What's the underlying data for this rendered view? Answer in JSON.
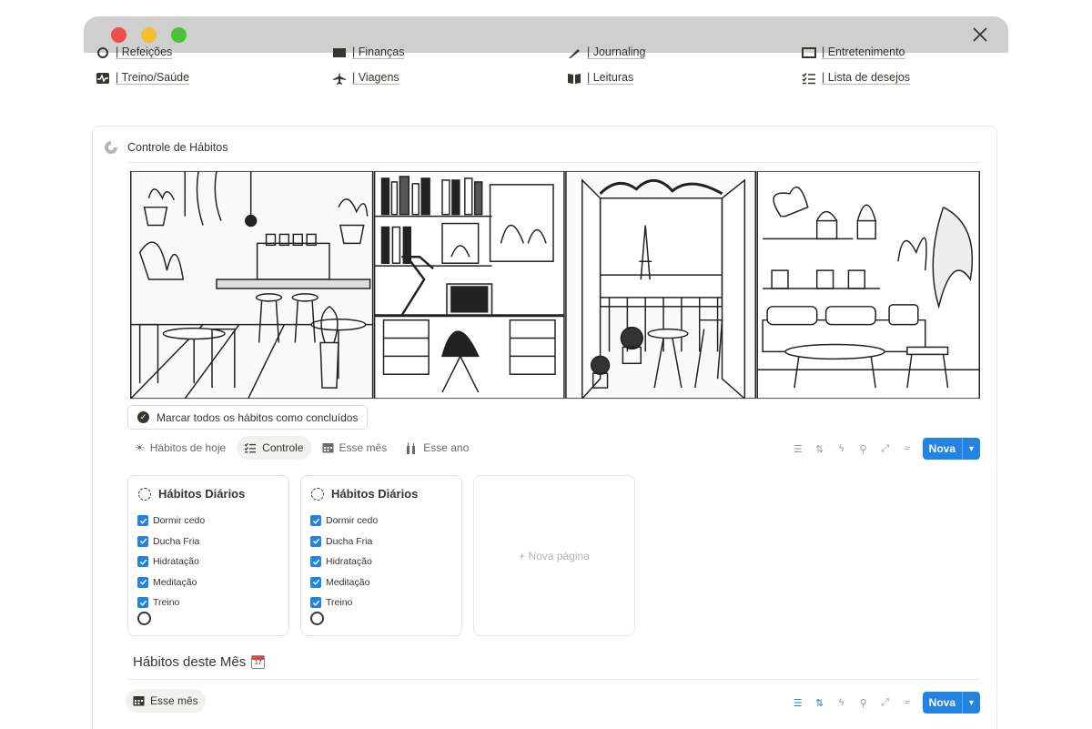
{
  "links": [
    {
      "label": "| Refeições",
      "icon": "bowl-icon"
    },
    {
      "label": "| Finanças",
      "icon": "wallet-icon"
    },
    {
      "label": "| Journaling",
      "icon": "pen-icon"
    },
    {
      "label": "| Entretenimento",
      "icon": "film-icon"
    },
    {
      "label": "| Treino/Saúde",
      "icon": "heart-pulse-icon"
    },
    {
      "label": "| Viagens",
      "icon": "airplane-icon"
    },
    {
      "label": "| Leituras",
      "icon": "book-icon"
    },
    {
      "label": "| Lista de desejos",
      "icon": "checklist-icon"
    }
  ],
  "panel": {
    "title": "Controle de Hábitos",
    "mark_all_label": "Marcar todos os hábitos como concluídos",
    "tabs": [
      {
        "label": "Hábitos de hoje",
        "icon": "sun-icon",
        "active": false
      },
      {
        "label": "Controle",
        "icon": "checklist-icon",
        "active": true
      },
      {
        "label": "Esse mês",
        "icon": "calendar-icon",
        "active": false
      },
      {
        "label": "Esse ano",
        "icon": "bottles-icon",
        "active": false
      }
    ],
    "new_button": "Nova",
    "cards": [
      {
        "title": "Hábitos Diários",
        "items": [
          "Dormir cedo",
          "Ducha Fria",
          "Hidratação",
          "Meditação",
          "Treino"
        ]
      },
      {
        "title": "Hábitos Diários",
        "items": [
          "Dormir cedo",
          "Ducha Fria",
          "Hidratação",
          "Meditação",
          "Treino"
        ]
      }
    ],
    "new_page_label": "+ Nova página",
    "month_section": {
      "title": "Hábitos deste Mês",
      "calendar_day": "17",
      "tab_label": "Esse mês",
      "new_button": "Nova"
    }
  },
  "colors": {
    "accent": "#2383e2",
    "text": "#37352f",
    "muted": "#9b9a97",
    "titlebar": "#cfcfcf"
  }
}
